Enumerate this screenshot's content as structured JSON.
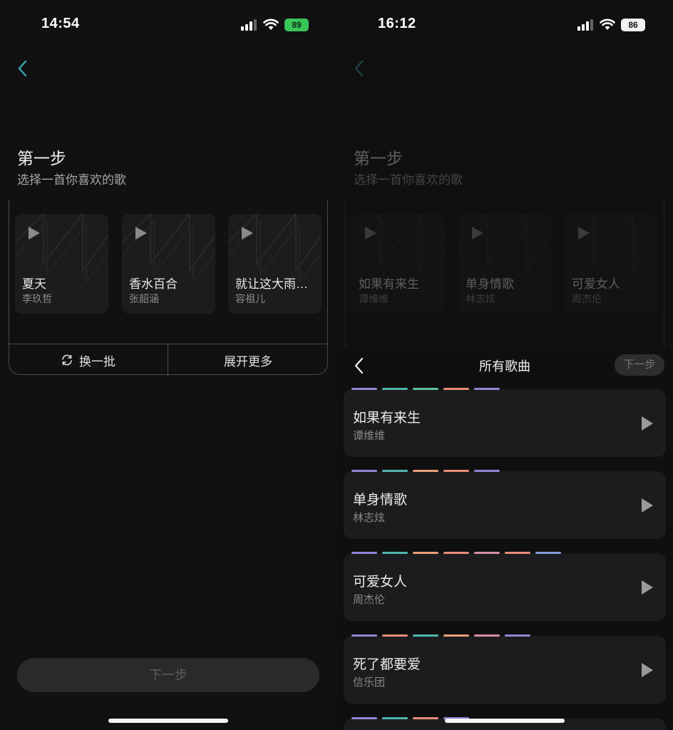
{
  "colors": {
    "accent_teal": "#3aa7b5",
    "battery_green": "#38c659",
    "dash_purple": "#8e86d6",
    "dash_teal": "#4fb6ad",
    "dash_green": "#5ec09a",
    "dash_salmon": "#e88c7a",
    "dash_pink": "#d88fa5",
    "dash_blue": "#7f9ddc"
  },
  "left": {
    "status": {
      "time": "14:54",
      "battery": "89"
    },
    "step_title": "第一步",
    "step_subtitle": "选择一首你喜欢的歌",
    "cards": [
      {
        "song": "夏天",
        "artist": "李玖哲"
      },
      {
        "song": "香水百合",
        "artist": "张韶涵"
      },
      {
        "song": "就让这大雨…",
        "artist": "容祖儿"
      }
    ],
    "refresh_label": "换一批",
    "expand_label": "展开更多",
    "next_label": "下一步"
  },
  "right": {
    "status": {
      "time": "16:12",
      "battery": "86"
    },
    "step_title": "第一步",
    "step_subtitle": "选择一首你喜欢的歌",
    "cards": [
      {
        "song": "如果有来生",
        "artist": "谭维维"
      },
      {
        "song": "单身情歌",
        "artist": "林志炫"
      },
      {
        "song": "可爱女人",
        "artist": "周杰伦"
      }
    ],
    "sheet": {
      "title": "所有歌曲",
      "next_label": "下一步",
      "songs": [
        {
          "song": "如果有来生",
          "artist": "谭维维"
        },
        {
          "song": "单身情歌",
          "artist": "林志炫"
        },
        {
          "song": "可爱女人",
          "artist": "周杰伦"
        },
        {
          "song": "死了都要爱",
          "artist": "信乐团"
        }
      ]
    }
  }
}
